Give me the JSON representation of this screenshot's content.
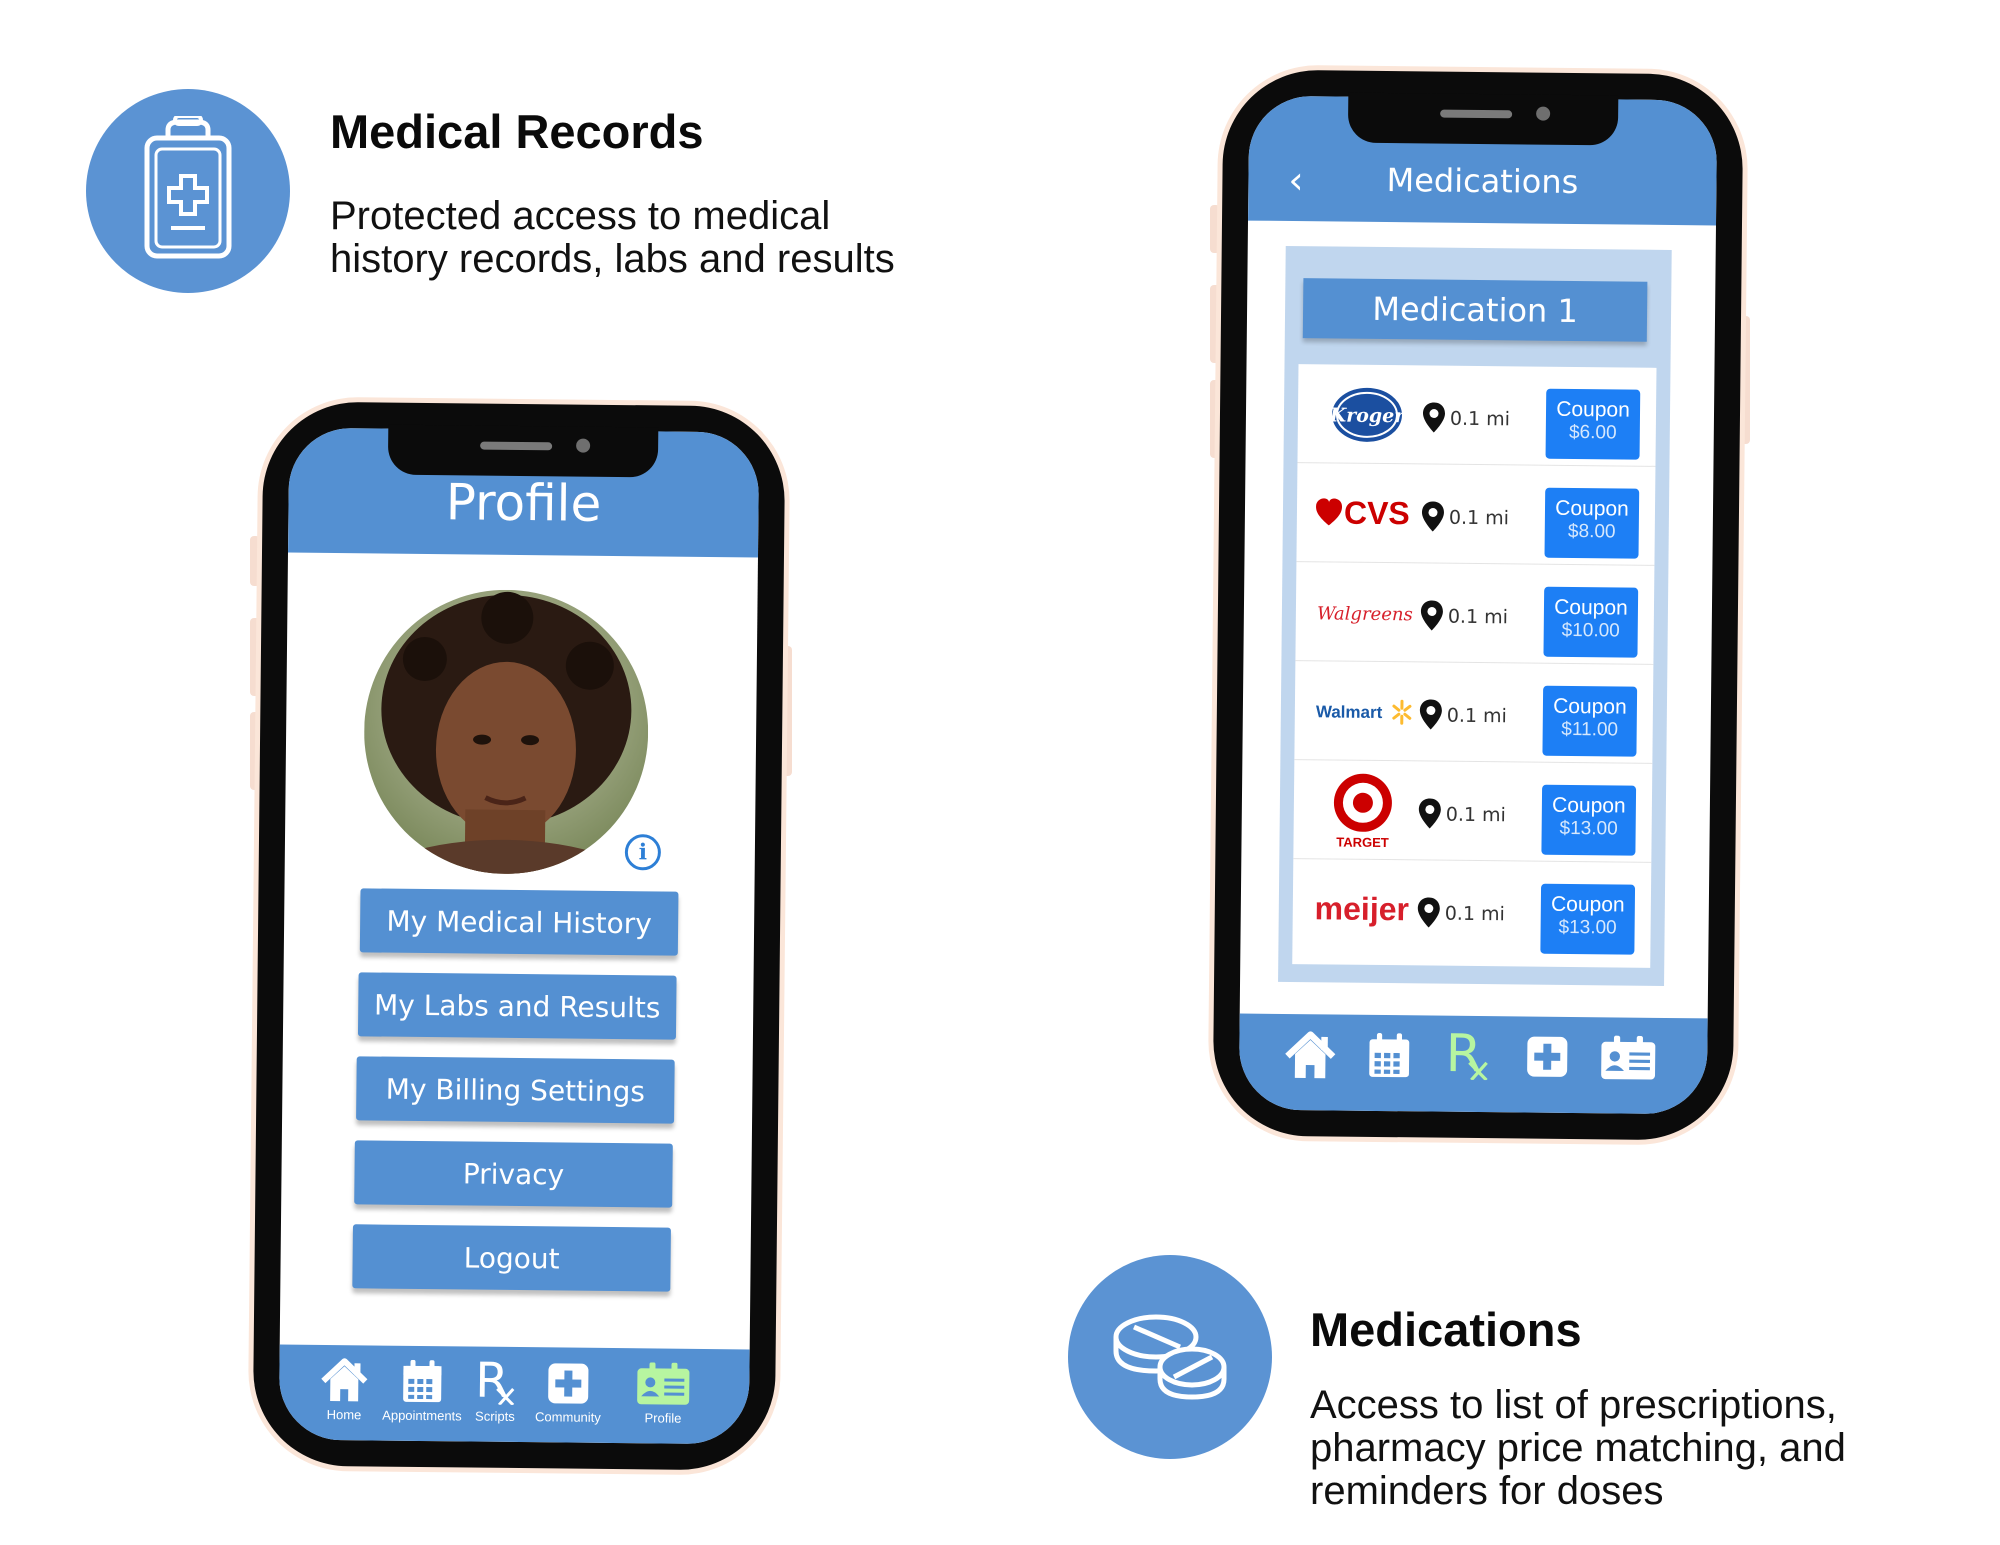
{
  "features": {
    "records": {
      "title": "Medical Records",
      "desc_line1": "Protected access to medical",
      "desc_line2": "history records, labs and results"
    },
    "medications": {
      "title": "Medications",
      "desc_line1": "Access to list of prescriptions,",
      "desc_line2": "pharmacy price matching, and",
      "desc_line3": "reminders for doses"
    }
  },
  "profile_screen": {
    "title": "Profile",
    "menu": [
      "My Medical History",
      "My Labs and Results",
      "My Billing Settings",
      "Privacy",
      "Logout"
    ],
    "nav": [
      "Home",
      "Appointments",
      "Scripts",
      "Community",
      "Profile"
    ],
    "active_nav": "Profile"
  },
  "medications_screen": {
    "title": "Medications",
    "medication_name": "Medication 1",
    "pharmacies": [
      {
        "name": "Kroger",
        "logo_text": "Kroger",
        "distance": "0.1 mi",
        "coupon_label": "Coupon",
        "price": "$6.00"
      },
      {
        "name": "CVS",
        "logo_text": "CVS",
        "distance": "0.1 mi",
        "coupon_label": "Coupon",
        "price": "$8.00"
      },
      {
        "name": "Walgreens",
        "logo_text": "Walgreens",
        "distance": "0.1 mi",
        "coupon_label": "Coupon",
        "price": "$10.00"
      },
      {
        "name": "Walmart",
        "logo_text": "Walmart",
        "distance": "0.1 mi",
        "coupon_label": "Coupon",
        "price": "$11.00"
      },
      {
        "name": "Target",
        "logo_text": "TARGET",
        "distance": "0.1 mi",
        "coupon_label": "Coupon",
        "price": "$13.00"
      },
      {
        "name": "Meijer",
        "logo_text": "meijer",
        "distance": "0.1 mi",
        "coupon_label": "Coupon",
        "price": "$13.00"
      }
    ],
    "active_nav": "Scripts"
  },
  "colors": {
    "brand_blue": "#5490d2",
    "coupon_blue": "#1d7ff5",
    "active_icon": "#b7f5a0",
    "panel": "#c0d6ee"
  }
}
